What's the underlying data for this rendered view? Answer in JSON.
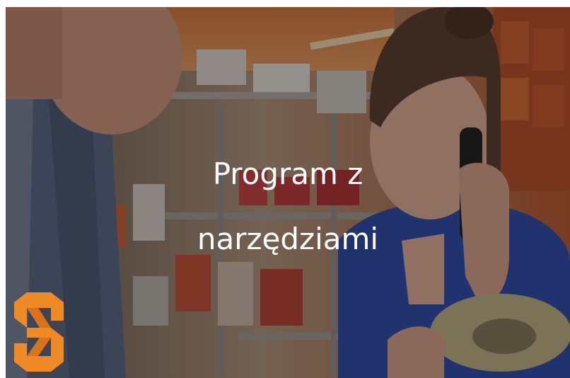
{
  "hero": {
    "headline_line1": "Program z",
    "headline_line2": "narzędziami",
    "logo_icon": "s-logo-icon"
  },
  "colors": {
    "logo_orange": "#f08a24",
    "overlay": "#141214"
  }
}
